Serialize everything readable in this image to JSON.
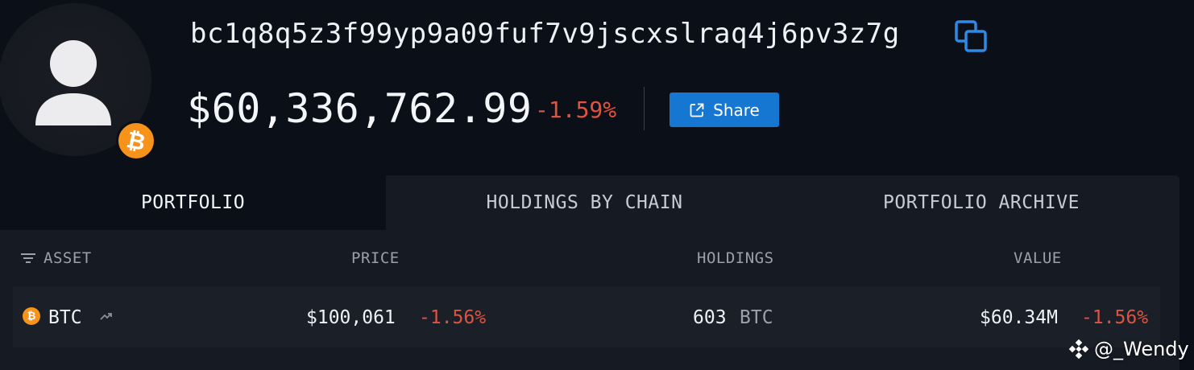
{
  "wallet": {
    "address": "bc1q8q5z3f99yp9a09fuf7v9jscxslraq4j6pv3z7g",
    "balance": "$60,336,762.99",
    "balance_change": "-1.59%",
    "share_label": "Share",
    "avatar_icon": "user-silhouette-icon",
    "chain_icon": "bitcoin-icon"
  },
  "tabs": [
    {
      "label": "PORTFOLIO",
      "active": true
    },
    {
      "label": "HOLDINGS BY CHAIN",
      "active": false
    },
    {
      "label": "PORTFOLIO ARCHIVE",
      "active": false
    }
  ],
  "table": {
    "headers": {
      "asset": "ASSET",
      "price": "PRICE",
      "holdings": "HOLDINGS",
      "value": "VALUE"
    },
    "rows": [
      {
        "asset": "BTC",
        "price": "$100,061",
        "price_change": "-1.56%",
        "holdings_amount": "603",
        "holdings_unit": "BTC",
        "value": "$60.34M",
        "value_change": "-1.56%"
      }
    ]
  },
  "watermark": "@_Wendy",
  "colors": {
    "accent": "#1677d2",
    "negative": "#e0533f",
    "bitcoin": "#f7931a",
    "background": "#0b0f18",
    "panel": "#161a22"
  }
}
